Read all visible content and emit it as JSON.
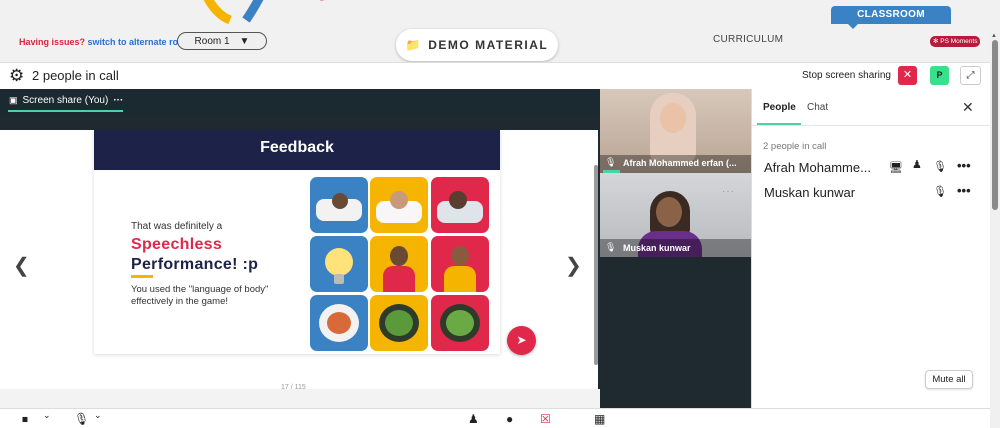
{
  "top": {
    "issues_label": "Having issues?",
    "alternate_room_link": "switch to alternate room",
    "room_value": "Room 1",
    "demo_material_label": "DEMO MATERIAL",
    "curriculum_label": "CURRICULUM",
    "classroom_label": "CLASSROOM",
    "ps_moments_label": "PS Moments"
  },
  "call": {
    "title": "2 people in call",
    "stop_sharing_label": "Stop screen sharing",
    "p_badge": "P"
  },
  "stage": {
    "share_tab_label": "Screen share (You)",
    "share_tab_more": "···",
    "page_indicator": "17 / 115"
  },
  "slide": {
    "title": "Feedback",
    "line1": "That was definitely a",
    "line2": "Speechless",
    "line3": "Performance! :p",
    "line4": "You used the \"language of body\" effectively in the game!"
  },
  "videos": [
    {
      "name": "Afrah Mohammed erfan (...",
      "mic": "🎙"
    },
    {
      "name": "Muskan kunwar",
      "mic": "🎙",
      "more": "···"
    }
  ],
  "panel": {
    "tab_people": "People",
    "tab_chat": "Chat",
    "close": "✕",
    "count_label": "2 people in call",
    "participants": [
      {
        "name": "Afrah Mohamme..."
      },
      {
        "name": "Muskan kunwar"
      }
    ],
    "mute_all_label": "Mute all"
  },
  "colors": {
    "accent_red": "#e0284a",
    "accent_green": "#4fd1a7",
    "classroom_blue": "#3b82c4",
    "slide_navy": "#1c2248"
  }
}
